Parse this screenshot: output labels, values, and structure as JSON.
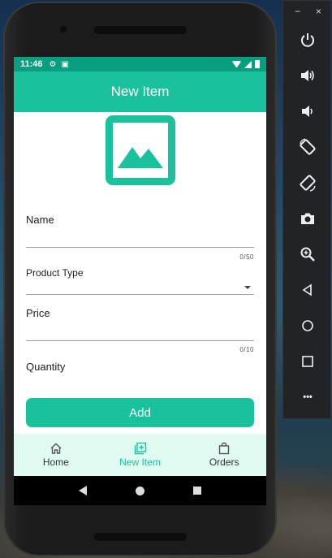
{
  "status_bar": {
    "time": "11:46"
  },
  "app_bar": {
    "title": "New Item"
  },
  "form": {
    "name_label": "Name",
    "name_counter": "0/50",
    "product_type_label": "Product Type",
    "price_label": "Price",
    "price_counter": "0/10",
    "quantity_label": "Quantity",
    "add_label": "Add"
  },
  "bottom_nav": {
    "items": [
      {
        "label": "Home",
        "icon": "home-icon",
        "active": false
      },
      {
        "label": "New Item",
        "icon": "add-box-icon",
        "active": true
      },
      {
        "label": "Orders",
        "icon": "bag-icon",
        "active": false
      }
    ]
  },
  "emulator_toolbar": {
    "minimize": "−",
    "close": "×",
    "more": "•••",
    "buttons": [
      "power-icon",
      "volume-up-icon",
      "volume-down-icon",
      "rotate-left-icon",
      "rotate-right-icon",
      "camera-icon",
      "zoom-icon",
      "back-icon",
      "home-icon",
      "overview-icon",
      "more-icon"
    ]
  },
  "colors": {
    "primary": "#19c29c",
    "primary_dark": "#089e80",
    "nav_background": "#e0fbf2"
  }
}
